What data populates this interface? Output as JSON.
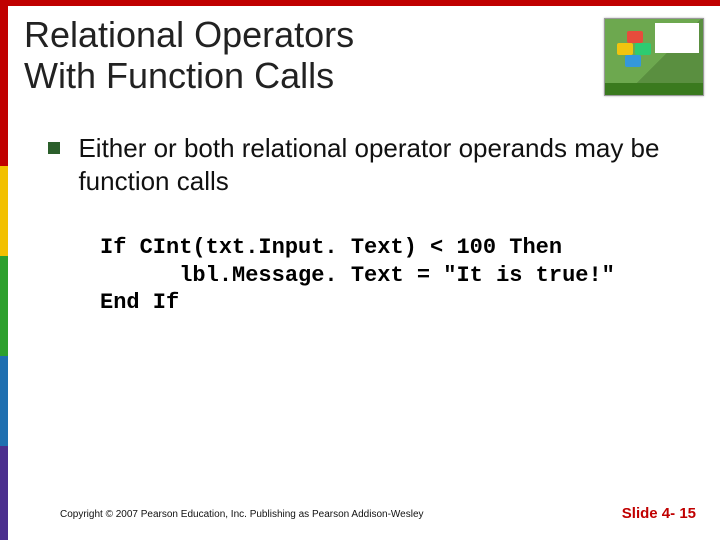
{
  "title_line1": "Relational Operators",
  "title_line2": "With Function Calls",
  "bullet": "Either or both relational operator operands may be function calls",
  "code": {
    "l1": "If CInt(txt.Input. Text) < 100 Then",
    "l2": "      lbl.Message. Text = \"It is true!\"",
    "l3": "End If"
  },
  "footer": {
    "copyright": "Copyright © 2007 Pearson Education, Inc. Publishing as Pearson Addison-Wesley",
    "slide": "Slide 4- 15"
  }
}
